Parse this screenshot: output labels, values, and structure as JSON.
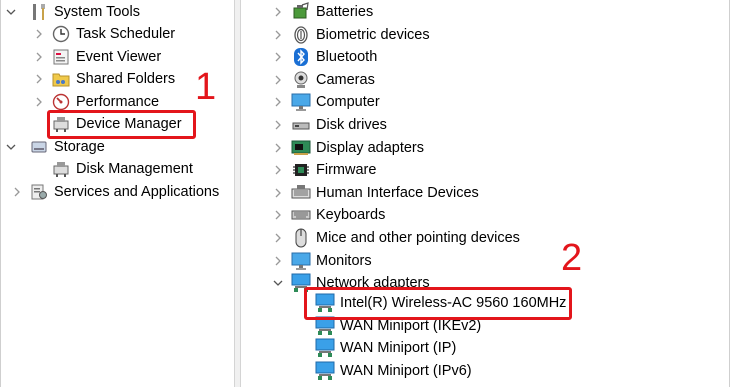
{
  "left_tree": {
    "system_tools": "System Tools",
    "task_scheduler": "Task Scheduler",
    "event_viewer": "Event Viewer",
    "shared_folders": "Shared Folders",
    "performance": "Performance",
    "device_manager": "Device Manager",
    "storage": "Storage",
    "disk_management": "Disk Management",
    "services_and_applications": "Services and Applications"
  },
  "device_tree": {
    "categories": [
      {
        "label": "Batteries",
        "icon": "battery-icon"
      },
      {
        "label": "Biometric devices",
        "icon": "fingerprint-icon"
      },
      {
        "label": "Bluetooth",
        "icon": "bluetooth-icon"
      },
      {
        "label": "Cameras",
        "icon": "webcam-icon"
      },
      {
        "label": "Computer",
        "icon": "monitor-icon"
      },
      {
        "label": "Disk drives",
        "icon": "disk-drive-icon"
      },
      {
        "label": "Display adapters",
        "icon": "display-adapter-icon"
      },
      {
        "label": "Firmware",
        "icon": "chip-icon"
      },
      {
        "label": "Human Interface Devices",
        "icon": "hid-icon"
      },
      {
        "label": "Keyboards",
        "icon": "keyboard-icon"
      },
      {
        "label": "Mice and other pointing devices",
        "icon": "mouse-icon"
      },
      {
        "label": "Monitors",
        "icon": "monitor-icon"
      },
      {
        "label": "Network adapters",
        "icon": "network-adapter-icon"
      }
    ],
    "network_adapters": [
      "Intel(R) Wireless-AC 9560 160MHz",
      "WAN Miniport (IKEv2)",
      "WAN Miniport (IP)",
      "WAN Miniport (IPv6)"
    ]
  },
  "annotations": {
    "marker_1": "1",
    "marker_2": "2"
  },
  "colors": {
    "highlight": "#e3151b",
    "splitter": "#f0f0f0"
  }
}
